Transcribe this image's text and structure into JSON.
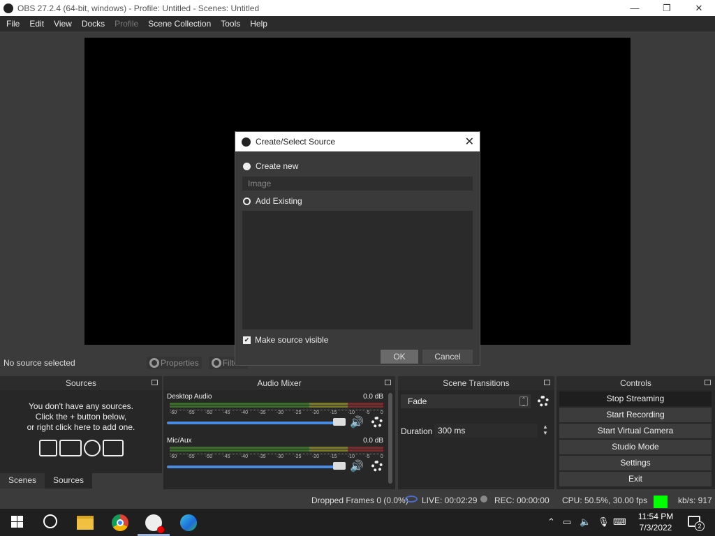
{
  "window": {
    "title": "OBS 27.2.4 (64-bit, windows) - Profile: Untitled - Scenes: Untitled"
  },
  "menu": [
    "File",
    "Edit",
    "View",
    "Docks",
    "Profile",
    "Scene Collection",
    "Tools",
    "Help"
  ],
  "source_toolbar": {
    "no_source": "No source selected",
    "properties": "Properties",
    "filters": "Filters"
  },
  "docks": {
    "sources": {
      "title": "Sources",
      "empty_hint": "You don't have any sources.\nClick the + button below,\nor right click here to add one."
    },
    "tabs": [
      "Scenes",
      "Sources"
    ],
    "mixer": {
      "title": "Audio Mixer",
      "channels": [
        {
          "name": "Desktop Audio",
          "db": "0.0 dB"
        },
        {
          "name": "Mic/Aux",
          "db": "0.0 dB"
        }
      ],
      "scale": [
        "-60",
        "-55",
        "-50",
        "-45",
        "-40",
        "-35",
        "-30",
        "-25",
        "-20",
        "-15",
        "-10",
        "-5",
        "0"
      ]
    },
    "transitions": {
      "title": "Scene Transitions",
      "selected": "Fade",
      "duration_label": "Duration",
      "duration_value": "300 ms"
    },
    "controls": {
      "title": "Controls",
      "buttons": [
        "Stop Streaming",
        "Start Recording",
        "Start Virtual Camera",
        "Studio Mode",
        "Settings",
        "Exit"
      ]
    }
  },
  "status": {
    "dropped": "Dropped Frames 0 (0.0%)",
    "live": "LIVE: 00:02:29",
    "rec": "REC: 00:00:00",
    "cpu": "CPU: 50.5%, 30.00 fps",
    "kbs": "kb/s: 917",
    "health_color": "#00ff00"
  },
  "dialog": {
    "title": "Create/Select Source",
    "create_new": "Create new",
    "name_value": "Image",
    "add_existing": "Add Existing",
    "make_visible": "Make source visible",
    "make_visible_checked": true,
    "ok": "OK",
    "cancel": "Cancel"
  },
  "taskbar": {
    "time": "11:54 PM",
    "date": "7/3/2022",
    "notifications": "2"
  }
}
